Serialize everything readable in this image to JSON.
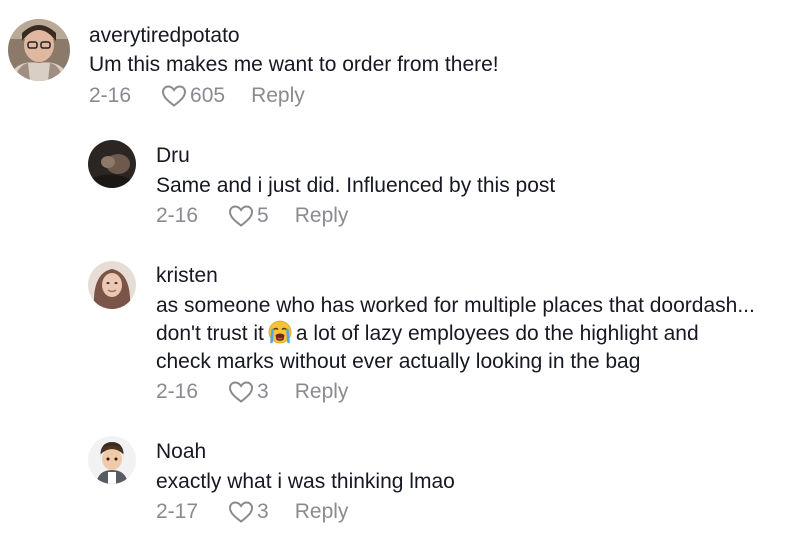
{
  "comments": [
    {
      "username": "averytiredpotato",
      "lines": [
        "Um this makes me want to order from there!"
      ],
      "date": "2-16",
      "likes": "605",
      "reply_label": "Reply"
    },
    {
      "username": "Dru",
      "lines": [
        "Same and i just did. Influenced by this post"
      ],
      "date": "2-16",
      "likes": "5",
      "reply_label": "Reply"
    },
    {
      "username": "kristen",
      "lines": [
        "as someone who has worked for multiple places that doordash...",
        "don't trust it",
        "a lot of lazy employees do the highlight and",
        "check marks without ever actually looking in the bag"
      ],
      "emoji": "loudly-crying-face-icon",
      "date": "2-16",
      "likes": "3",
      "reply_label": "Reply"
    },
    {
      "username": "Noah",
      "lines": [
        "exactly what i was thinking lmao"
      ],
      "date": "2-17",
      "likes": "3",
      "reply_label": "Reply"
    }
  ],
  "colors": {
    "text": "#161823",
    "secondary": "#8a8b91"
  }
}
